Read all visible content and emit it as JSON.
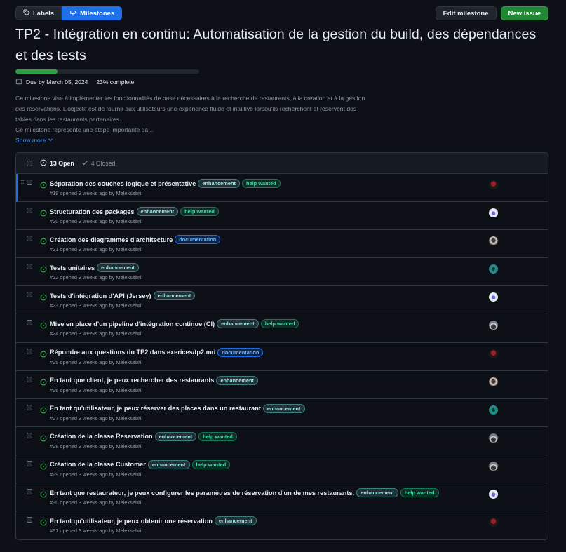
{
  "header": {
    "labels_button": "Labels",
    "milestones_button": "Milestones",
    "edit_milestone_button": "Edit milestone",
    "new_issue_button": "New issue"
  },
  "milestone": {
    "title": "TP2 - Intégration en continu: Automatisation de la gestion du build, des dépendances et des tests",
    "progress_fraction": 0.23,
    "due": "Due by March 05, 2024",
    "complete": "23% complete",
    "description_lines": [
      "Ce milestone vise à implémenter les fonctionnalités de base nécessaires à la recherche de restaurants, à la création et à la gestion",
      "des réservations. L'objectif est de fournir aux utilisateurs une expérience fluide et intuitive lorsqu'ils recherchent et réservent des",
      "tables dans les restaurants partenaires.",
      "Ce milestone représente une étape importante da..."
    ],
    "show_more": "Show more"
  },
  "issue_list": {
    "open_count": "13 Open",
    "closed_count": "4 Closed",
    "issues": [
      {
        "title": "Séparation des couches logique et présentative",
        "labels": [
          {
            "text": "enhancement",
            "kind": "enh"
          },
          {
            "text": "help wanted",
            "kind": "help"
          }
        ],
        "meta": "#19 opened 3 weeks ago by Meleksebri",
        "avatar": "av-dark"
      },
      {
        "title": "Structuration des packages",
        "labels": [
          {
            "text": "enhancement",
            "kind": "enh"
          },
          {
            "text": "help wanted",
            "kind": "help"
          }
        ],
        "meta": "#20 opened 3 weeks ago by Meleksebri",
        "avatar": "av-white"
      },
      {
        "title": "Création des diagrammes d'architecture",
        "labels": [
          {
            "text": "documentation",
            "kind": "doc"
          }
        ],
        "meta": "#21 opened 3 weeks ago by Meleksebri",
        "avatar": "av-photo"
      },
      {
        "title": "Tests unitaires",
        "labels": [
          {
            "text": "enhancement",
            "kind": "enh"
          }
        ],
        "meta": "#22 opened 3 weeks ago by Meleksebri",
        "avatar": "av-teal"
      },
      {
        "title": "Tests d'intégration d'API (Jersey)",
        "labels": [
          {
            "text": "enhancement",
            "kind": "enh"
          }
        ],
        "meta": "#23 opened 3 weeks ago by Meleksebri",
        "avatar": "av-white"
      },
      {
        "title": "Mise en place d'un pipeline d'intégration continue (CI)",
        "labels": [
          {
            "text": "enhancement",
            "kind": "enh"
          },
          {
            "text": "help wanted",
            "kind": "help"
          }
        ],
        "meta": "#24 opened 3 weeks ago by Meleksebri",
        "avatar": "av-person"
      },
      {
        "title": "Répondre aux questions du TP2 dans exerices/tp2.md",
        "labels": [
          {
            "text": "documentation",
            "kind": "doc"
          }
        ],
        "meta": "#25 opened 3 weeks ago by Meleksebri",
        "avatar": "av-dark"
      },
      {
        "title": "En tant que client, je peux rechercher des restaurants",
        "labels": [
          {
            "text": "enhancement",
            "kind": "enh"
          }
        ],
        "meta": "#26 opened 3 weeks ago by Meleksebri",
        "avatar": "av-photo"
      },
      {
        "title": "En tant qu'utilisateur, je peux réserver des places dans un restaurant",
        "labels": [
          {
            "text": "enhancement",
            "kind": "enh"
          }
        ],
        "meta": "#27 opened 3 weeks ago by Meleksebri",
        "avatar": "av-teal"
      },
      {
        "title": "Création de la classe Reservation",
        "labels": [
          {
            "text": "enhancement",
            "kind": "enh"
          },
          {
            "text": "help wanted",
            "kind": "help"
          }
        ],
        "meta": "#28 opened 3 weeks ago by Meleksebri",
        "avatar": "av-person"
      },
      {
        "title": "Création de la classe Customer",
        "labels": [
          {
            "text": "enhancement",
            "kind": "enh"
          },
          {
            "text": "help wanted",
            "kind": "help"
          }
        ],
        "meta": "#29 opened 3 weeks ago by Meleksebri",
        "avatar": "av-person"
      },
      {
        "title": "En tant que restaurateur, je peux configurer les paramètres de réservation d'un de mes restaurants.",
        "labels": [
          {
            "text": "enhancement",
            "kind": "enh"
          },
          {
            "text": "help wanted",
            "kind": "help"
          }
        ],
        "meta": "#30 opened 3 weeks ago by Meleksebri",
        "avatar": "av-white"
      },
      {
        "title": "En tant qu'utilisateur, je peux obtenir une réservation",
        "labels": [
          {
            "text": "enhancement",
            "kind": "enh"
          }
        ],
        "meta": "#31 opened 3 weeks ago by Meleksebri",
        "avatar": "av-dark"
      }
    ]
  }
}
